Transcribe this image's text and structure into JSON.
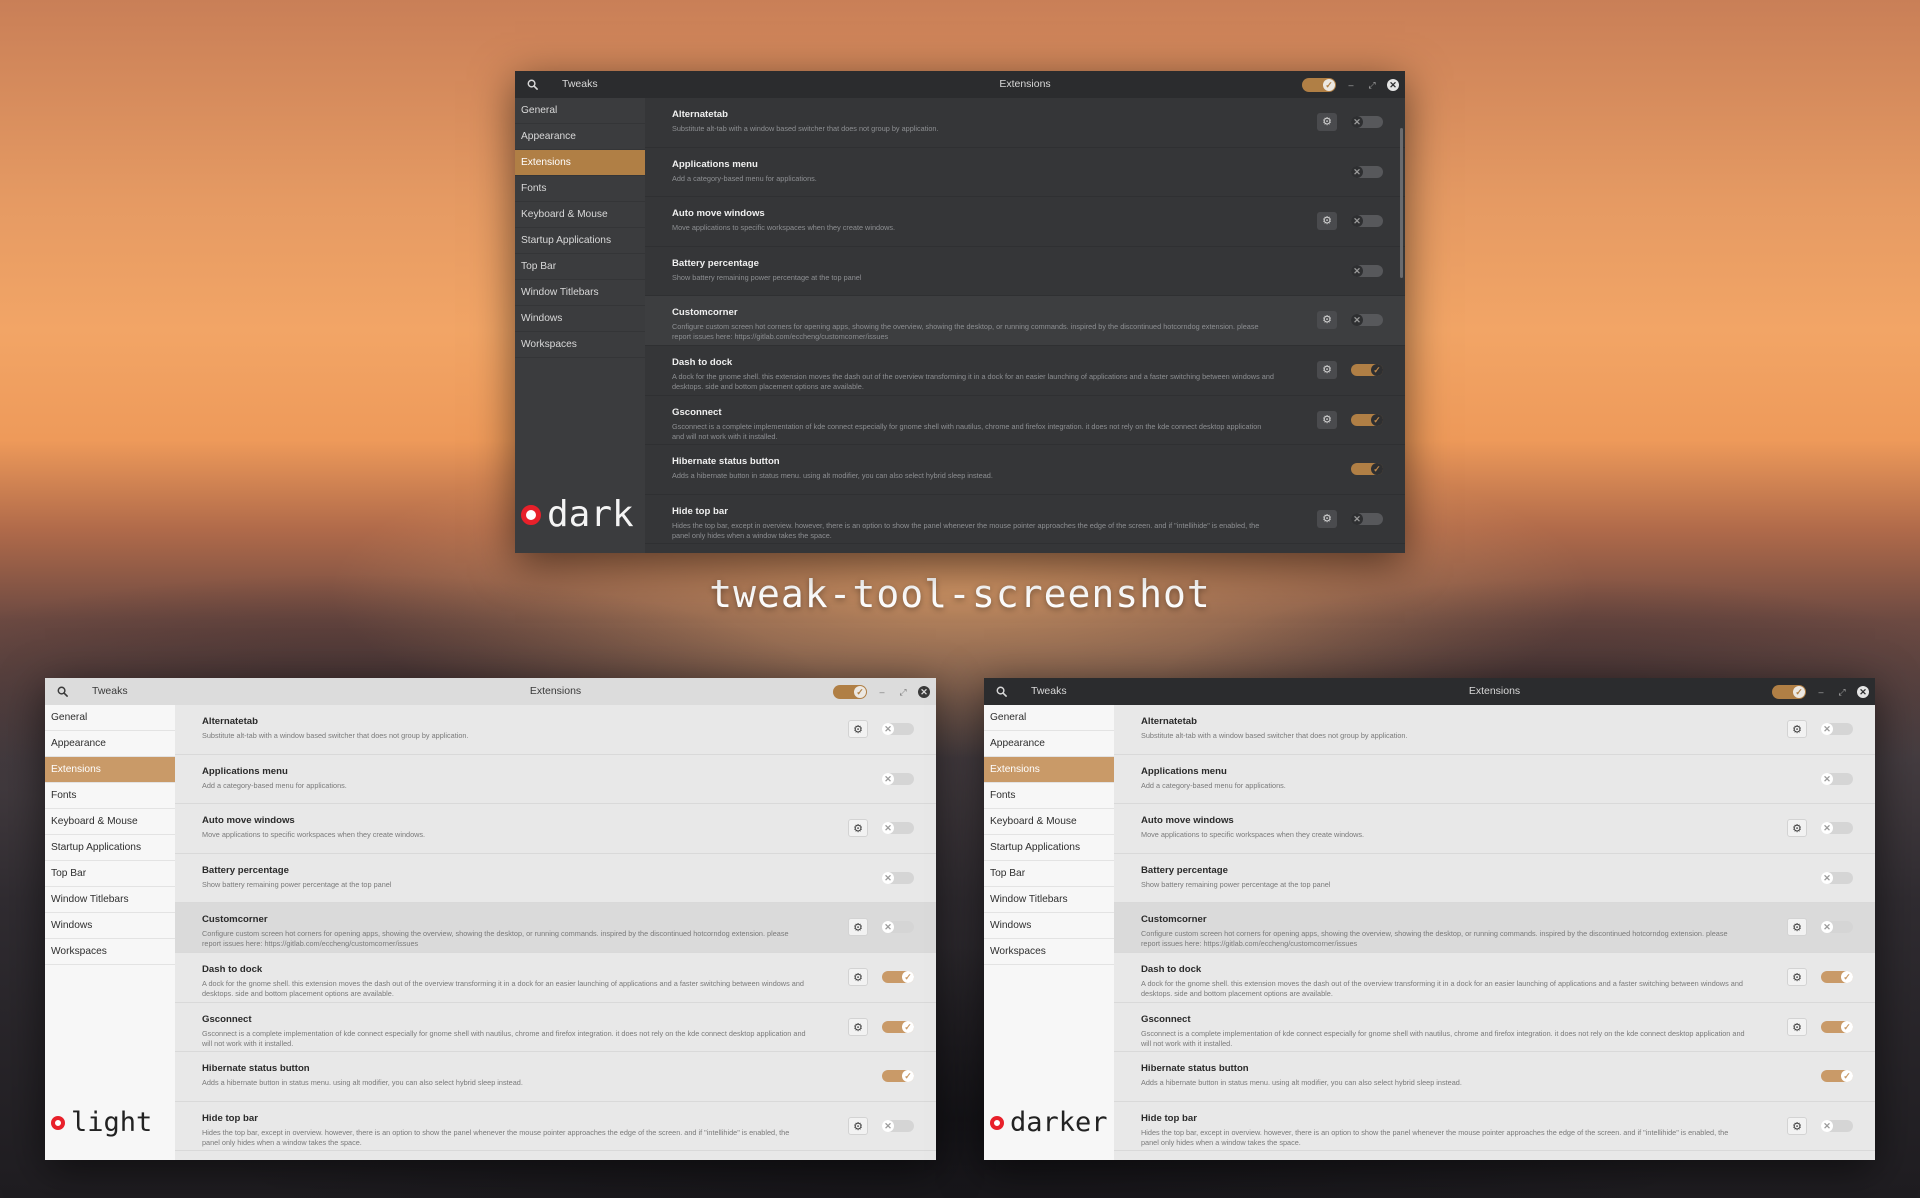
{
  "caption": "tweak-tool-screenshot",
  "colors": {
    "accent": "#b07f45",
    "badge_red": "#e8202a"
  },
  "icons": {
    "search": "search-icon",
    "gear": "gear-icon",
    "close": "close-icon",
    "minimize": "minimize-icon",
    "maximize": "maximize-icon",
    "check": "check-icon",
    "x": "x-icon"
  },
  "windows": [
    {
      "theme": "dark",
      "badge": "dark",
      "app_name": "Tweaks",
      "title": "Extensions",
      "selected_index": 2,
      "sidebar": [
        "General",
        "Appearance",
        "Extensions",
        "Fonts",
        "Keyboard & Mouse",
        "Startup Applications",
        "Top Bar",
        "Window Titlebars",
        "Windows",
        "Workspaces"
      ],
      "rows": [
        {
          "name": "Alternatetab",
          "desc": "Substitute alt-tab with a window based switcher that does not group by application.",
          "gear": true,
          "on": false
        },
        {
          "name": "Applications menu",
          "desc": "Add a category-based menu for applications.",
          "gear": false,
          "on": false
        },
        {
          "name": "Auto move windows",
          "desc": "Move applications to specific workspaces when they create windows.",
          "gear": true,
          "on": false
        },
        {
          "name": "Battery percentage",
          "desc": "Show battery remaining power percentage at the top panel",
          "gear": false,
          "on": false
        },
        {
          "name": "Customcorner",
          "desc": "Configure custom screen hot corners for opening apps, showing the overview, showing the desktop, or running commands. inspired by the discontinued hotcorndog extension. please report issues here: https://gitlab.com/eccheng/customcorner/issues",
          "gear": true,
          "on": false
        },
        {
          "name": "Dash to dock",
          "desc": "A dock for the gnome shell. this extension moves the dash out of the overview transforming it in a dock for an easier launching of applications and a faster switching between windows and desktops. side and bottom placement options are available.",
          "gear": true,
          "on": true
        },
        {
          "name": "Gsconnect",
          "desc": "Gsconnect is a complete implementation of kde connect especially for gnome shell with nautilus, chrome and firefox integration. it does not rely on the kde connect desktop application and will not work with it installed.",
          "gear": true,
          "on": true
        },
        {
          "name": "Hibernate status button",
          "desc": "Adds a hibernate button in status menu. using alt modifier, you can also select hybrid sleep instead.",
          "gear": false,
          "on": true
        },
        {
          "name": "Hide top bar",
          "desc": "Hides the top bar, except in overview. however, there is an option to show the panel whenever the mouse pointer approaches the edge of the screen. and if \"intellihide\" is enabled, the panel only hides when a window takes the space.",
          "gear": true,
          "on": false
        }
      ]
    },
    {
      "theme": "light",
      "badge": "light",
      "app_name": "Tweaks",
      "title": "Extensions",
      "selected_index": 2,
      "sidebar": [
        "General",
        "Appearance",
        "Extensions",
        "Fonts",
        "Keyboard & Mouse",
        "Startup Applications",
        "Top Bar",
        "Window Titlebars",
        "Windows",
        "Workspaces"
      ],
      "rows": [
        {
          "name": "Alternatetab",
          "desc": "Substitute alt-tab with a window based switcher that does not group by application.",
          "gear": true,
          "on": false
        },
        {
          "name": "Applications menu",
          "desc": "Add a category-based menu for applications.",
          "gear": false,
          "on": false
        },
        {
          "name": "Auto move windows",
          "desc": "Move applications to specific workspaces when they create windows.",
          "gear": true,
          "on": false
        },
        {
          "name": "Battery percentage",
          "desc": "Show battery remaining power percentage at the top panel",
          "gear": false,
          "on": false
        },
        {
          "name": "Customcorner",
          "desc": "Configure custom screen hot corners for opening apps, showing the overview, showing the desktop, or running commands. inspired by the discontinued hotcorndog extension. please report issues here: https://gitlab.com/eccheng/customcorner/issues",
          "gear": true,
          "on": false
        },
        {
          "name": "Dash to dock",
          "desc": "A dock for the gnome shell. this extension moves the dash out of the overview transforming it in a dock for an easier launching of applications and a faster switching between windows and desktops. side and bottom placement options are available.",
          "gear": true,
          "on": true
        },
        {
          "name": "Gsconnect",
          "desc": "Gsconnect is a complete implementation of kde connect especially for gnome shell with nautilus, chrome and firefox integration. it does not rely on the kde connect desktop application and will not work with it installed.",
          "gear": true,
          "on": true
        },
        {
          "name": "Hibernate status button",
          "desc": "Adds a hibernate button in status menu. using alt modifier, you can also select hybrid sleep instead.",
          "gear": false,
          "on": true
        },
        {
          "name": "Hide top bar",
          "desc": "Hides the top bar, except in overview. however, there is an option to show the panel whenever the mouse pointer approaches the edge of the screen. and if \"intellihide\" is enabled, the panel only hides when a window takes the space.",
          "gear": true,
          "on": false
        }
      ]
    },
    {
      "theme": "darker",
      "badge": "darker",
      "app_name": "Tweaks",
      "title": "Extensions",
      "selected_index": 2,
      "sidebar": [
        "General",
        "Appearance",
        "Extensions",
        "Fonts",
        "Keyboard & Mouse",
        "Startup Applications",
        "Top Bar",
        "Window Titlebars",
        "Windows",
        "Workspaces"
      ],
      "rows": [
        {
          "name": "Alternatetab",
          "desc": "Substitute alt-tab with a window based switcher that does not group by application.",
          "gear": true,
          "on": false
        },
        {
          "name": "Applications menu",
          "desc": "Add a category-based menu for applications.",
          "gear": false,
          "on": false
        },
        {
          "name": "Auto move windows",
          "desc": "Move applications to specific workspaces when they create windows.",
          "gear": true,
          "on": false
        },
        {
          "name": "Battery percentage",
          "desc": "Show battery remaining power percentage at the top panel",
          "gear": false,
          "on": false
        },
        {
          "name": "Customcorner",
          "desc": "Configure custom screen hot corners for opening apps, showing the overview, showing the desktop, or running commands. inspired by the discontinued hotcorndog extension. please report issues here: https://gitlab.com/eccheng/customcorner/issues",
          "gear": true,
          "on": false
        },
        {
          "name": "Dash to dock",
          "desc": "A dock for the gnome shell. this extension moves the dash out of the overview transforming it in a dock for an easier launching of applications and a faster switching between windows and desktops. side and bottom placement options are available.",
          "gear": true,
          "on": true
        },
        {
          "name": "Gsconnect",
          "desc": "Gsconnect is a complete implementation of kde connect especially for gnome shell with nautilus, chrome and firefox integration. it does not rely on the kde connect desktop application and will not work with it installed.",
          "gear": true,
          "on": true
        },
        {
          "name": "Hibernate status button",
          "desc": "Adds a hibernate button in status menu. using alt modifier, you can also select hybrid sleep instead.",
          "gear": false,
          "on": true
        },
        {
          "name": "Hide top bar",
          "desc": "Hides the top bar, except in overview. however, there is an option to show the panel whenever the mouse pointer approaches the edge of the screen. and if \"intellihide\" is enabled, the panel only hides when a window takes the space.",
          "gear": true,
          "on": false
        }
      ]
    }
  ]
}
